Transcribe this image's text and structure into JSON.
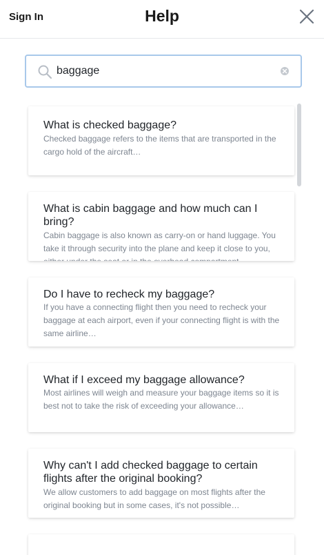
{
  "header": {
    "sign_in": "Sign In",
    "title": "Help"
  },
  "search": {
    "value": "baggage",
    "placeholder": ""
  },
  "results": [
    {
      "question": "What is checked baggage?",
      "answer": "Checked baggage refers to the items that are transported in the cargo hold of the aircraft…"
    },
    {
      "question": "What is cabin baggage and how much can I bring?",
      "answer": "Cabin baggage is also known as carry-on or hand luggage. You take it through security into the plane and keep it close to you, either under the seat or in the overhead compartment…"
    },
    {
      "question": "Do I have to recheck my baggage?",
      "answer": "If you have a connecting flight then you need to recheck your baggage at each airport, even if your connecting flight is with the same airline…"
    },
    {
      "question": "What if I exceed my baggage allowance?",
      "answer": "Most airlines will weigh and measure your baggage items so it is best not to take the risk of exceeding your allowance…"
    },
    {
      "question": "Why can't I add checked baggage to certain flights after the original booking?",
      "answer": "We allow customers to add baggage on most flights after the original booking but in some cases, it's not possible…"
    }
  ],
  "icons": {
    "close": "close-icon",
    "search": "search-icon",
    "clear": "clear-icon"
  },
  "colors": {
    "search_border": "#a8c8ea",
    "answer_text": "#7d8590"
  }
}
